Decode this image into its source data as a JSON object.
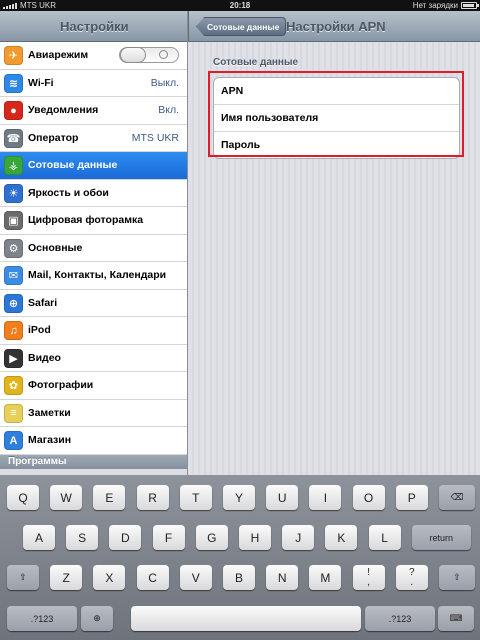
{
  "statusbar": {
    "carrier": "MTS UKR",
    "time": "20:18",
    "battery_text": "Нет зарядки"
  },
  "left_pane": {
    "title": "Настройки",
    "items": [
      {
        "label": "Авиарежим",
        "icon": "airplane-icon",
        "color": "#f29a2e",
        "glyph": "✈",
        "toggle": true
      },
      {
        "label": "Wi-Fi",
        "icon": "wifi-icon",
        "color": "#2f88e6",
        "glyph": "≋",
        "value": "Выкл."
      },
      {
        "label": "Уведомления",
        "icon": "notifications-icon",
        "color": "#d7261c",
        "glyph": "●",
        "value": "Вкл."
      },
      {
        "label": "Оператор",
        "icon": "phone-icon",
        "color": "#6f7a86",
        "glyph": "☎",
        "value": "MTS UKR"
      },
      {
        "label": "Сотовые данные",
        "icon": "cellular-data-icon",
        "color": "#38a73a",
        "glyph": "⚶",
        "selected": true
      },
      {
        "label": "Яркость и обои",
        "icon": "brightness-icon",
        "color": "#2f6fd0",
        "glyph": "☀"
      },
      {
        "label": "Цифровая фоторамка",
        "icon": "photo-frame-icon",
        "color": "#6b6b6b",
        "glyph": "▣"
      },
      {
        "label": "Основные",
        "icon": "gear-icon",
        "color": "#7c838b",
        "glyph": "⚙"
      },
      {
        "label": "Mail, Контакты, Календари",
        "icon": "mail-icon",
        "color": "#3c8be3",
        "glyph": "✉"
      },
      {
        "label": "Safari",
        "icon": "safari-compass-icon",
        "color": "#2c77d6",
        "glyph": "⊕"
      },
      {
        "label": "iPod",
        "icon": "ipod-icon",
        "color": "#f07e1b",
        "glyph": "♫"
      },
      {
        "label": "Видео",
        "icon": "video-clapper-icon",
        "color": "#333",
        "glyph": "▶"
      },
      {
        "label": "Фотографии",
        "icon": "sunflower-icon",
        "color": "#e3b31c",
        "glyph": "✿"
      },
      {
        "label": "Заметки",
        "icon": "notes-icon",
        "color": "#e8cf5a",
        "glyph": "≡"
      },
      {
        "label": "Магазин",
        "icon": "app-store-icon",
        "color": "#2f7fe0",
        "glyph": "A"
      }
    ],
    "section": "Программы"
  },
  "right_pane": {
    "back_label": "Сотовые данные",
    "title": "Настройки APN",
    "group_label": "Сотовые данные",
    "rows": [
      "APN",
      "Имя пользователя",
      "Пароль"
    ],
    "highlight_color": "#e01b2c"
  },
  "keyboard": {
    "row1": [
      "Q",
      "W",
      "E",
      "R",
      "T",
      "Y",
      "U",
      "I",
      "O",
      "P"
    ],
    "row2": [
      "A",
      "S",
      "D",
      "F",
      "G",
      "H",
      "J",
      "K",
      "L"
    ],
    "row3": [
      "Z",
      "X",
      "C",
      "V",
      "B",
      "N",
      "M"
    ],
    "return_label": "return",
    "numbers_label": ".?123",
    "row3_extra": [
      {
        "top": "!",
        "bottom": ","
      },
      {
        "top": "?",
        "bottom": "."
      }
    ]
  }
}
